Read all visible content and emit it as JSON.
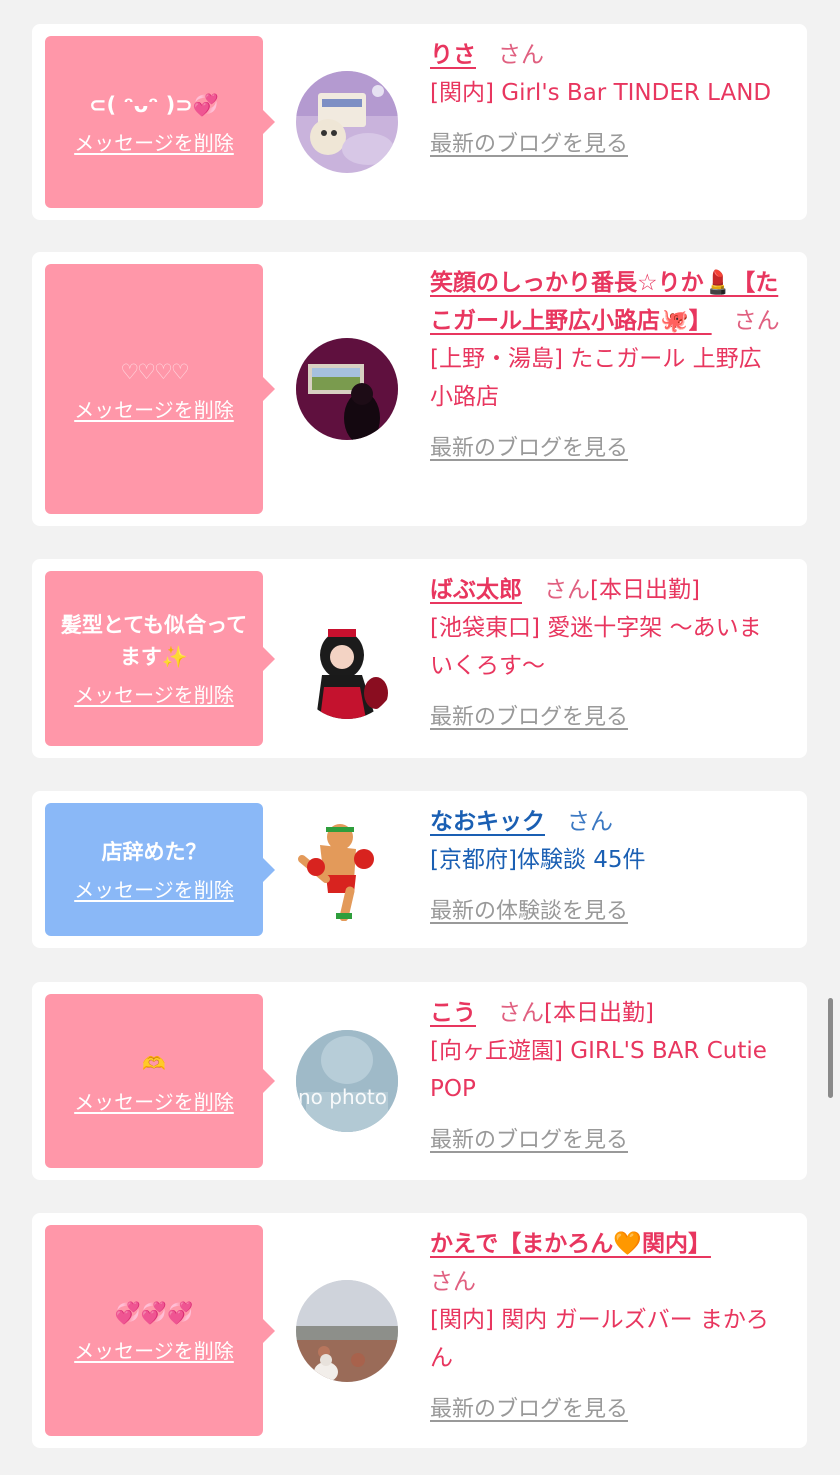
{
  "delete_label": "メッセージを削除",
  "cards": [
    {
      "message": "⊂( ᵔᴗᵔ )⊃💞",
      "name": "りさ",
      "honorific": "さん",
      "status": "",
      "place": "[関内] Girl's Bar TINDER LAND",
      "link": "最新のブログを見る"
    },
    {
      "message": "♡♡♡♡",
      "name": "笑顔のしっかり番長☆りか💄【たこガール上野広小路店🐙】",
      "honorific": "さん",
      "status": "",
      "place": "[上野・湯島] たこガール 上野広小路店",
      "link": "最新のブログを見る"
    },
    {
      "message": "髪型とても似合ってます✨",
      "name": "ばぶ太郎",
      "honorific": "さん",
      "status": "[本日出勤]",
      "place": "[池袋東口] 愛迷十字架 〜あいまいくろす〜",
      "link": "最新のブログを見る"
    },
    {
      "message": "店辞めた？",
      "name": "なおキック",
      "honorific": "さん",
      "status": "",
      "place": "[京都府]体験談 45件",
      "link": "最新の体験談を見る"
    },
    {
      "message": "🫶",
      "name": "こう",
      "honorific": "さん",
      "status": "[本日出勤]",
      "place": "[向ヶ丘遊園] GIRL'S BAR Cutie POP",
      "link": "最新のブログを見る",
      "avatar_text": "no photo"
    },
    {
      "message": "💞💞💞",
      "name": "かえで【まかろん🧡関内】",
      "honorific": "さん",
      "status": "",
      "place": "[関内] 関内 ガールズバー まかろん",
      "link": "最新のブログを見る"
    }
  ],
  "colors": {
    "pink_bubble": "#ff97a9",
    "blue_bubble": "#8ab8f7",
    "pink_text": "#e8365f",
    "blue_text": "#1a5fb3"
  }
}
